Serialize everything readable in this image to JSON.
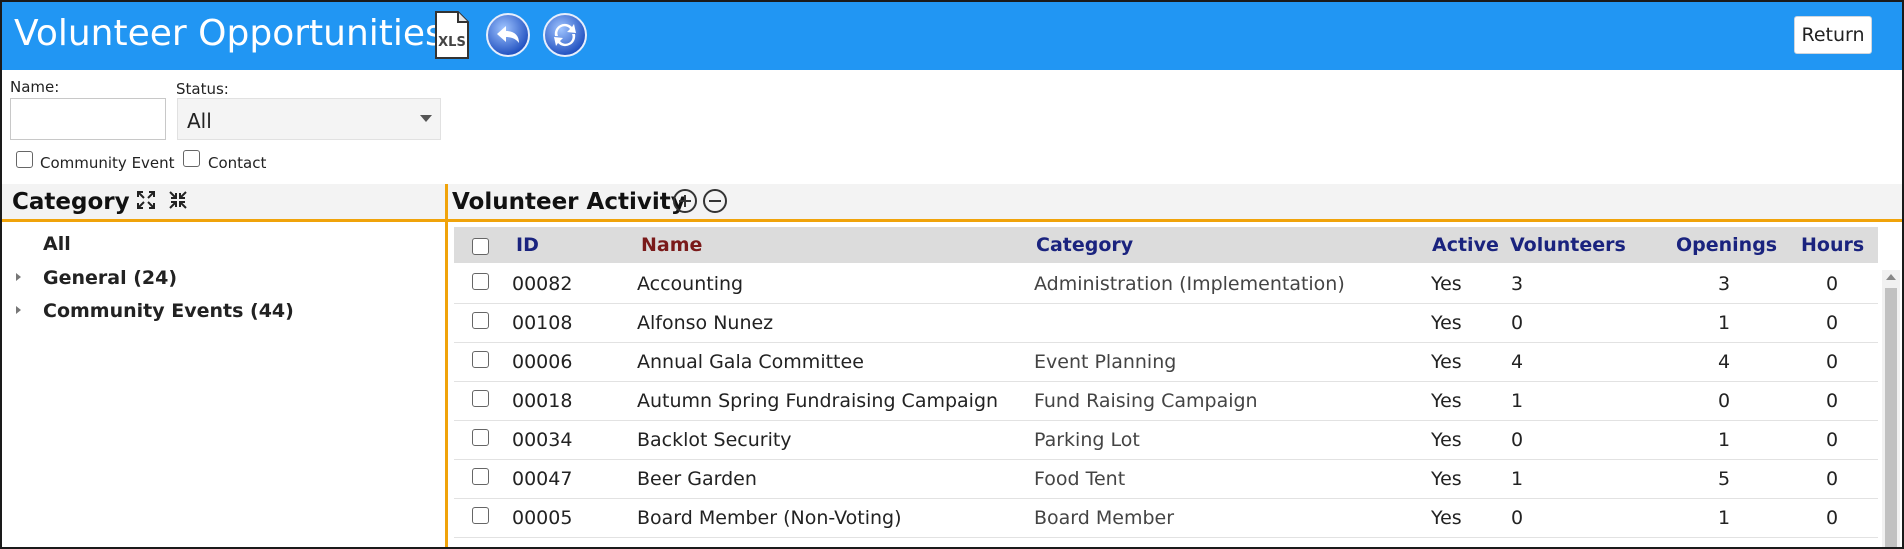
{
  "header": {
    "title": "Volunteer Opportunities",
    "return_label": "Return",
    "icons": [
      "xls-export-icon",
      "undo-icon",
      "refresh-icon"
    ],
    "xls_label": "XLS",
    "accent": "#2196f3"
  },
  "filters": {
    "name_label": "Name:",
    "name_value": "",
    "status_label": "Status:",
    "status_value": "All",
    "community_event_label": "Community Event",
    "contact_label": "Contact"
  },
  "category_panel": {
    "title": "Category",
    "items": [
      {
        "label": "All"
      },
      {
        "label": "General (24)"
      },
      {
        "label": "Community Events (44)"
      }
    ]
  },
  "activity_panel": {
    "title": "Volunteer Activity",
    "columns": {
      "id": "ID",
      "name": "Name",
      "category": "Category",
      "active": "Active",
      "volunteers": "Volunteers",
      "openings": "Openings",
      "hours": "Hours"
    },
    "rows": [
      {
        "id": "00082",
        "name": "Accounting",
        "category": "Administration (Implementation)",
        "active": "Yes",
        "volunteers": "3",
        "openings": "3",
        "hours": "0"
      },
      {
        "id": "00108",
        "name": "Alfonso Nunez",
        "category": "",
        "active": "Yes",
        "volunteers": "0",
        "openings": "1",
        "hours": "0"
      },
      {
        "id": "00006",
        "name": "Annual Gala Committee",
        "category": "Event Planning",
        "active": "Yes",
        "volunteers": "4",
        "openings": "4",
        "hours": "0"
      },
      {
        "id": "00018",
        "name": "Autumn Spring Fundraising Campaign",
        "category": "Fund Raising Campaign",
        "active": "Yes",
        "volunteers": "1",
        "openings": "0",
        "hours": "0"
      },
      {
        "id": "00034",
        "name": "Backlot Security",
        "category": "Parking Lot",
        "active": "Yes",
        "volunteers": "0",
        "openings": "1",
        "hours": "0"
      },
      {
        "id": "00047",
        "name": "Beer Garden",
        "category": "Food Tent",
        "active": "Yes",
        "volunteers": "1",
        "openings": "5",
        "hours": "0"
      },
      {
        "id": "00005",
        "name": "Board Member (Non-Voting)",
        "category": "Board Member",
        "active": "Yes",
        "volunteers": "0",
        "openings": "1",
        "hours": "0"
      }
    ]
  }
}
